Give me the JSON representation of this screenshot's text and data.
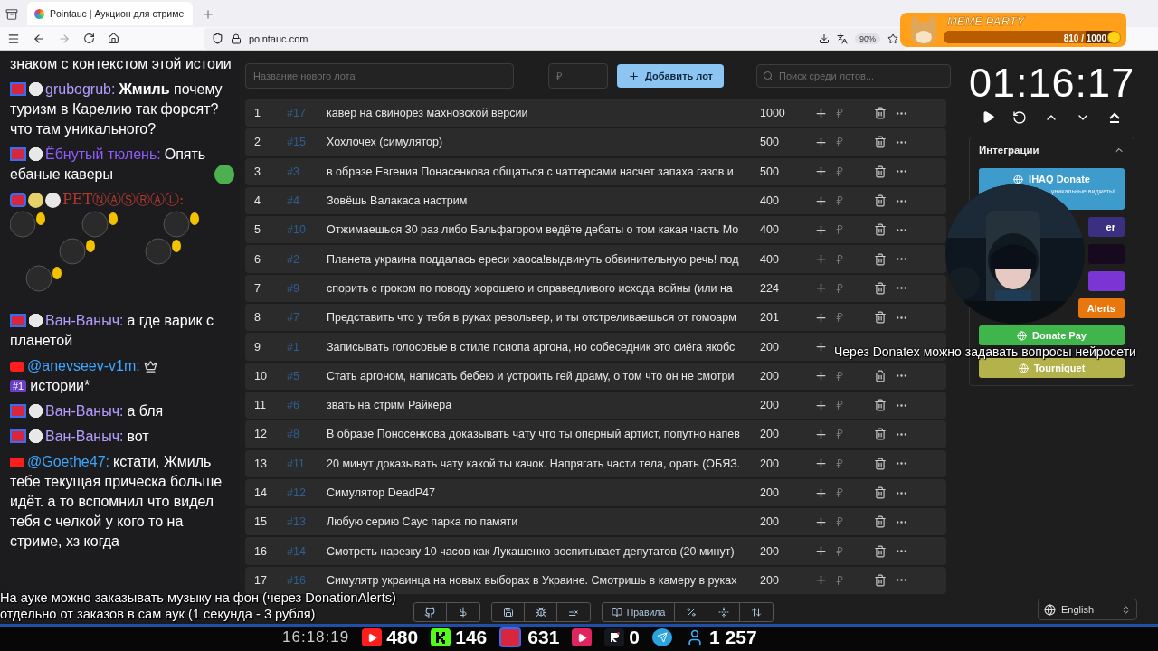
{
  "browser": {
    "tab_title": "Pointauc | Аукцион для стриме",
    "url": "pointauc.com",
    "zoom": "90%"
  },
  "meme_widget": {
    "title": "MEME PARTY",
    "progress": "810 / 1000",
    "level": 0.81
  },
  "chat": [
    {
      "text": "знаком с контекстом этой истоии"
    },
    {
      "badges": [
        {
          "kind": "live"
        },
        {
          "kind": "emote"
        }
      ],
      "author": "grubogrub:",
      "color": "#b49dff",
      "text": "**Жмиль** почему туризм в Карелию так форсят? что там уникального?"
    },
    {
      "badges": [
        {
          "kind": "live"
        },
        {
          "kind": "emote"
        }
      ],
      "author": "Ёбнутый тюлень:",
      "color": "#8f5cff",
      "text": "Опять ебаные каверы",
      "trail_emote": true
    },
    {
      "badges": [
        {
          "kind": "live"
        },
        {
          "kind": "glass"
        },
        {
          "kind": "emote"
        }
      ],
      "author": "PETⓃⒶⓈⓇⒶⓁ:",
      "color": "#b03a2e",
      "emote_grid": true
    },
    {
      "badges": [
        {
          "kind": "live"
        },
        {
          "kind": "emote"
        }
      ],
      "author": "Ван-Ваныч:",
      "color": "#b49dff",
      "text": "а где варик с планетой"
    },
    {
      "badges": [
        {
          "kind": "youtube"
        }
      ],
      "author": "@anevseev-v1m:",
      "color": "#3ea6ff",
      "crown": true,
      "rank": "#1",
      "text": "истории*"
    },
    {
      "badges": [
        {
          "kind": "live"
        },
        {
          "kind": "emote"
        }
      ],
      "author": "Ван-Ваныч:",
      "color": "#b49dff",
      "text": "а бля"
    },
    {
      "badges": [
        {
          "kind": "live"
        },
        {
          "kind": "emote"
        }
      ],
      "author": "Ван-Ваныч:",
      "color": "#b49dff",
      "text": "вот"
    },
    {
      "badges": [
        {
          "kind": "youtube"
        }
      ],
      "author": "@Goethe47:",
      "color": "#3ea6ff",
      "text": "кстати, Жмиль тебе текущая прическа больше идёт. а то вспомнил что видел тебя с челкой у кого то на стриме, хз когда"
    }
  ],
  "new_lot": {
    "name_placeholder": "Название нового лота",
    "amount_placeholder": "₽",
    "add_button": "Добавить лот",
    "search_placeholder": "Поиск среди лотов..."
  },
  "lots": [
    {
      "index": "1",
      "id": "#17",
      "title": "кавер на свинорез махновской версии",
      "amount": "1000"
    },
    {
      "index": "2",
      "id": "#15",
      "title": "Хохлочех (симулятор)",
      "amount": "500"
    },
    {
      "index": "3",
      "id": "#3",
      "title": "в образе Евгения Понасенкова общаться с чаттерсами насчет запаха газов и",
      "amount": "500"
    },
    {
      "index": "4",
      "id": "#4",
      "title": "Зовёшь Валакаса настрим",
      "amount": "400"
    },
    {
      "index": "5",
      "id": "#10",
      "title": "Отжимаешься 30 раз либо Бальфагором ведёте дебаты о том какая часть Мо",
      "amount": "400"
    },
    {
      "index": "6",
      "id": "#2",
      "title": "Планета украина поддалась ереси хаоса!выдвинуть обвинительную речь! под",
      "amount": "400"
    },
    {
      "index": "7",
      "id": "#9",
      "title": "спорить с гроком по поводу хорошего и справедливого исхода войны (или на",
      "amount": "224"
    },
    {
      "index": "8",
      "id": "#7",
      "title": "Представить что у тебя в руках револьвер, и ты отстреливаешься от гомоарм",
      "amount": "201"
    },
    {
      "index": "9",
      "id": "#1",
      "title": "Записывать голосовые в стиле псиопа аргона, но собеседник это сиёга якобс",
      "amount": "200",
      "icons_covered": true
    },
    {
      "index": "10",
      "id": "#5",
      "title": "Стать аргоном, написать бебею и устроить гей драму, о том что он не смотри",
      "amount": "200"
    },
    {
      "index": "11",
      "id": "#6",
      "title": "звать на стрим Райкера",
      "amount": "200"
    },
    {
      "index": "12",
      "id": "#8",
      "title": "В образе Поносенкова доказывать чату что ты оперный артист, попутно напев",
      "amount": "200"
    },
    {
      "index": "13",
      "id": "#11",
      "title": "20 минут доказывать чату какой ты качок. Напрягать части тела, орать (ОБЯЗ.",
      "amount": "200"
    },
    {
      "index": "14",
      "id": "#12",
      "title": "Симулятор DeadP47",
      "amount": "200"
    },
    {
      "index": "15",
      "id": "#13",
      "title": "Любую серию Саус парка по памяти",
      "amount": "200"
    },
    {
      "index": "16",
      "id": "#14",
      "title": "Смотреть нарезку 10 часов как Лукашенко воспитывает депутатов (20 минут)",
      "amount": "200"
    },
    {
      "index": "17",
      "id": "#16",
      "title": "Симулятр украинца на новых выборах в Украине. Смотришь в камеру в руках",
      "amount": "200"
    }
  ],
  "timer": "01:16:17",
  "integrations": {
    "title": "Интеграции",
    "items": [
      {
        "kind": "full",
        "label": "IHAQ Donate",
        "note": "уникальные виджеты!",
        "color": "#3d9ccc"
      },
      {
        "kind": "covered",
        "label": "er",
        "color": "#3a2f80"
      },
      {
        "kind": "covered",
        "color": "#180a1e"
      },
      {
        "kind": "covered",
        "color": "#7b35d4"
      },
      {
        "kind": "covered",
        "label": "Alerts",
        "color": "#e8780e"
      },
      {
        "kind": "full",
        "label": "Donate Pay",
        "color": "#3fb54c"
      },
      {
        "kind": "full",
        "label": "Tourniquet",
        "color": "#b4b24a"
      }
    ]
  },
  "toolbar": {
    "rules": "Правила"
  },
  "language": "English",
  "subtitles": [
    {
      "text": "На ауке можно заказывать музыку на фон (через DonationAlerts) отдельно от заказов в сам аук (1 секунда - 3 рубля)"
    },
    {
      "text": "Через Donatex можно задавать вопросы нейросети"
    }
  ],
  "stream_bar": {
    "time": "16:18:19",
    "stats": [
      {
        "kind": "youtube",
        "count": "480"
      },
      {
        "kind": "kick",
        "count": "146"
      },
      {
        "kind": "live",
        "count": "631"
      },
      {
        "kind": "play"
      },
      {
        "kind": "rutube",
        "count": "0"
      },
      {
        "kind": "telegram"
      },
      {
        "kind": "viewers",
        "count": "1 257"
      }
    ]
  }
}
